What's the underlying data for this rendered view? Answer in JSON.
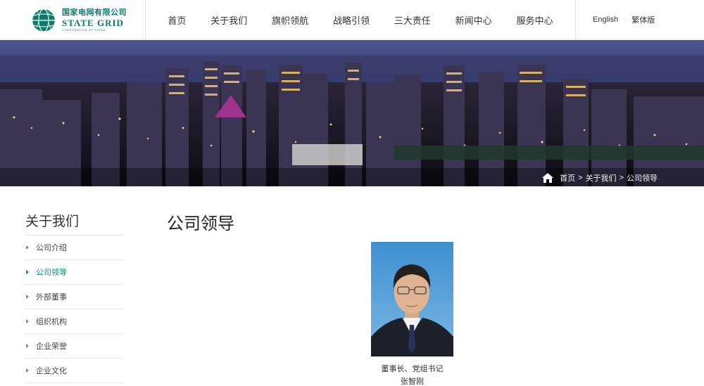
{
  "header": {
    "logo": {
      "cn": "国家电网有限公司",
      "en": "State Grid",
      "sub": "CORPORATION OF CHINA",
      "color": "#0e7a6e"
    },
    "nav": [
      {
        "label": "首页"
      },
      {
        "label": "关于我们"
      },
      {
        "label": "旗帜领航"
      },
      {
        "label": "战略引领"
      },
      {
        "label": "三大责任"
      },
      {
        "label": "新闻中心"
      },
      {
        "label": "服务中心"
      }
    ],
    "lang": {
      "english": "English",
      "traditional": "繁体版"
    }
  },
  "breadcrumb": {
    "icon": "home-icon",
    "items": [
      "首页",
      "关于我们",
      "公司领导"
    ],
    "separator": ">"
  },
  "sidebar": {
    "title": "关于我们",
    "items": [
      {
        "label": "公司介绍"
      },
      {
        "label": "公司领导"
      },
      {
        "label": "外部董事"
      },
      {
        "label": "组织机构"
      },
      {
        "label": "企业荣誉"
      },
      {
        "label": "企业文化"
      }
    ],
    "active_index": 1,
    "accent": "#11877a"
  },
  "main": {
    "title": "公司领导",
    "leader": {
      "position": "董事长、党组书记",
      "name": "张智刚"
    }
  }
}
